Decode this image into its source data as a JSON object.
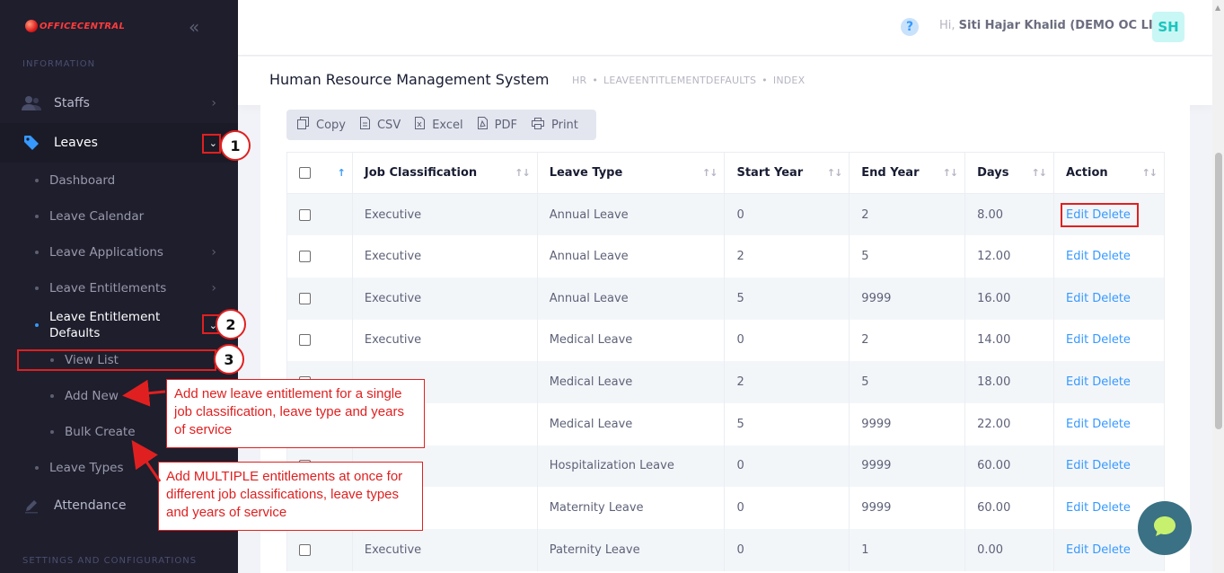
{
  "app": {
    "logo_text": "OFFICECENTRAL",
    "collapse_glyph": "«"
  },
  "sidebar": {
    "section_top": "INFORMATION",
    "section_bottom": "SETTINGS AND CONFIGURATIONS",
    "items": [
      {
        "label": "Staffs",
        "icon": "users-icon"
      },
      {
        "label": "Leaves",
        "icon": "tag-icon"
      },
      {
        "label": "Attendance",
        "icon": "pen-icon"
      }
    ],
    "leaves_sub": [
      {
        "label": "Dashboard"
      },
      {
        "label": "Leave Calendar"
      },
      {
        "label": "Leave Applications"
      },
      {
        "label": "Leave Entitlements"
      },
      {
        "label": "Leave Entitlement Defaults"
      },
      {
        "label": "Leave Types"
      }
    ],
    "defaults_sub": [
      {
        "label": "View List"
      },
      {
        "label": "Add New"
      },
      {
        "label": "Bulk Create"
      }
    ]
  },
  "annotations": {
    "n1": "1",
    "n2": "2",
    "n3": "3",
    "callout_add_new": "Add new leave entitlement for a single job classification, leave type and years of service",
    "callout_bulk": "Add MULTIPLE entitlements at once for different job classifications, leave types and years of service"
  },
  "header": {
    "help_glyph": "?",
    "greeting_prefix": "Hi,",
    "user_name": "Siti Hajar Khalid (DEMO OC LITE)",
    "avatar_initials": "SH"
  },
  "subheader": {
    "title": "Human Resource Management System",
    "breadcrumb": [
      "HR",
      "LEAVEENTITLEMENTDEFAULTS",
      "INDEX"
    ]
  },
  "toolbar": {
    "buttons": [
      {
        "label": "Copy",
        "icon": "copy-icon"
      },
      {
        "label": "CSV",
        "icon": "csv-file-icon"
      },
      {
        "label": "Excel",
        "icon": "excel-file-icon"
      },
      {
        "label": "PDF",
        "icon": "pdf-file-icon"
      },
      {
        "label": "Print",
        "icon": "printer-icon"
      }
    ]
  },
  "table": {
    "columns": [
      "Job Classification",
      "Leave Type",
      "Start Year",
      "End Year",
      "Days",
      "Action"
    ],
    "edit_label": "Edit",
    "delete_label": "Delete",
    "rows": [
      {
        "job": "Executive",
        "leave_type": "Annual Leave",
        "start": "0",
        "end": "2",
        "days": "8.00"
      },
      {
        "job": "Executive",
        "leave_type": "Annual Leave",
        "start": "2",
        "end": "5",
        "days": "12.00"
      },
      {
        "job": "Executive",
        "leave_type": "Annual Leave",
        "start": "5",
        "end": "9999",
        "days": "16.00"
      },
      {
        "job": "Executive",
        "leave_type": "Medical Leave",
        "start": "0",
        "end": "2",
        "days": "14.00"
      },
      {
        "job": "",
        "leave_type": "Medical Leave",
        "start": "2",
        "end": "5",
        "days": "18.00"
      },
      {
        "job": "",
        "leave_type": "Medical Leave",
        "start": "5",
        "end": "9999",
        "days": "22.00"
      },
      {
        "job": "",
        "leave_type": "Hospitalization Leave",
        "start": "0",
        "end": "9999",
        "days": "60.00"
      },
      {
        "job": "",
        "leave_type": "Maternity Leave",
        "start": "0",
        "end": "9999",
        "days": "60.00"
      },
      {
        "job": "Executive",
        "leave_type": "Paternity Leave",
        "start": "0",
        "end": "1",
        "days": "0.00"
      }
    ]
  },
  "colors": {
    "sidebar_bg": "#1e1e2d",
    "accent": "#3699ff",
    "annotation_red": "#e02020"
  }
}
